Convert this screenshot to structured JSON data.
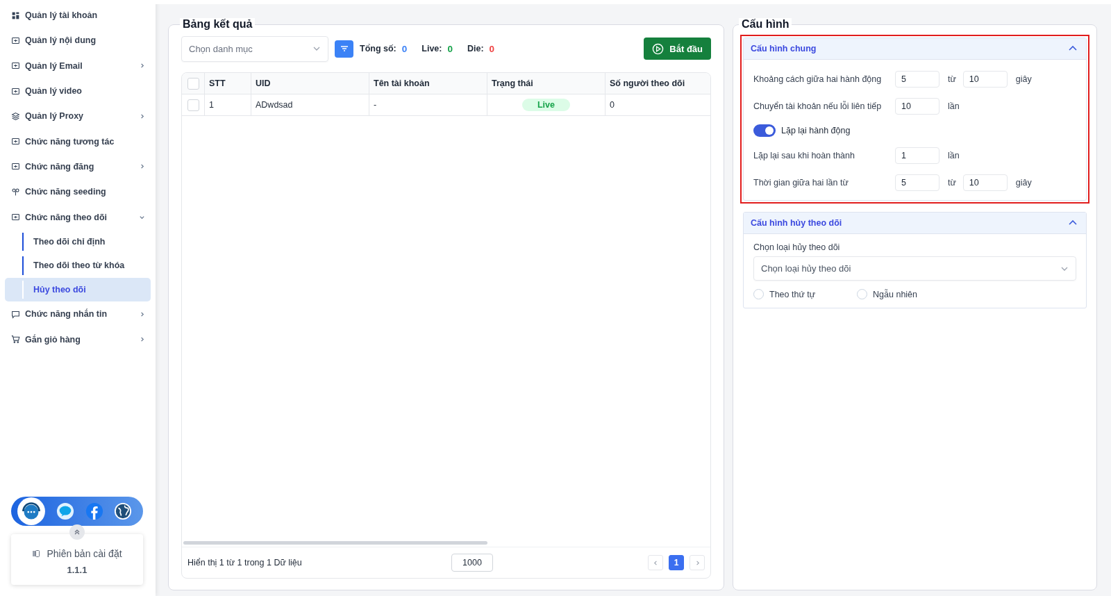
{
  "sidebar": {
    "items": [
      {
        "label": "Quản lý tài khoản"
      },
      {
        "label": "Quản lý nội dung"
      },
      {
        "label": "Quản lý Email",
        "expanded": false
      },
      {
        "label": "Quản lý video"
      },
      {
        "label": "Quản lý Proxy",
        "expanded": false
      },
      {
        "label": "Chức năng tương tác"
      },
      {
        "label": "Chức năng đăng",
        "expanded": false
      },
      {
        "label": "Chức năng seeding"
      },
      {
        "label": "Chức năng theo dõi",
        "expanded": true,
        "children": [
          {
            "label": "Theo dõi chỉ định",
            "selected": false
          },
          {
            "label": "Theo dõi theo từ khóa",
            "selected": false
          },
          {
            "label": "Hủy theo dõi",
            "selected": true
          }
        ]
      },
      {
        "label": "Chức năng nhắn tin",
        "expanded": false
      },
      {
        "label": "Gắn giỏ hàng",
        "expanded": false
      }
    ],
    "version": {
      "label": "Phiên bản cài đặt",
      "value": "1.1.1"
    }
  },
  "results": {
    "title": "Bảng kết quả",
    "category_select": {
      "placeholder": "Chọn danh mục"
    },
    "stats": [
      {
        "label": "Tổng số:",
        "value": "0",
        "color": "#3b82f6"
      },
      {
        "label": "Live:",
        "value": "0",
        "color": "#16a34a"
      },
      {
        "label": "Die:",
        "value": "0",
        "color": "#ef4444"
      }
    ],
    "start_button": "Bắt đầu",
    "table": {
      "all_checked": false,
      "columns": [
        "STT",
        "UID",
        "Tên tài khoản",
        "Trạng thái",
        "Số người theo dõi"
      ],
      "rows": [
        {
          "checked": false,
          "cells": [
            "1",
            "ADwdsad",
            "-",
            "Live",
            "0"
          ]
        }
      ]
    },
    "footer": {
      "summary": "Hiển thị 1 từ 1 trong 1 Dữ liệu",
      "page_size": "1000",
      "pages": [
        {
          "label": "1",
          "selected": true
        }
      ]
    }
  },
  "config": {
    "title": "Cấu hình",
    "sections": [
      {
        "title": "Cấu hình chung",
        "expanded": true,
        "highlighted": true,
        "rows": [
          {
            "kind": "range",
            "label": "Khoảng cách giữa hai hành động",
            "from": "5",
            "sep": "từ",
            "to": "10",
            "unit": "giây"
          },
          {
            "kind": "single",
            "label": "Chuyển tài khoản nếu lỗi liên tiếp",
            "value": "10",
            "unit": "lần"
          },
          {
            "kind": "toggle",
            "label": "Lặp lại hành động",
            "on": true
          },
          {
            "kind": "single",
            "label": "Lặp lại sau khi hoàn thành",
            "value": "1",
            "unit": "lần"
          },
          {
            "kind": "range",
            "label": "Thời gian giữa hai lần từ",
            "from": "5",
            "sep": "từ",
            "to": "10",
            "unit": "giây"
          }
        ]
      },
      {
        "title": "Cấu hình hủy theo dõi",
        "expanded": true,
        "highlighted": false,
        "rows": [
          {
            "kind": "select",
            "label": "Chọn loại hủy theo dõi",
            "placeholder": "Chọn loại hủy theo dõi"
          },
          {
            "kind": "radios",
            "options": [
              {
                "label": "Theo thứ tự",
                "selected": false
              },
              {
                "label": "Ngẫu nhiên",
                "selected": false
              }
            ]
          }
        ]
      }
    ]
  }
}
